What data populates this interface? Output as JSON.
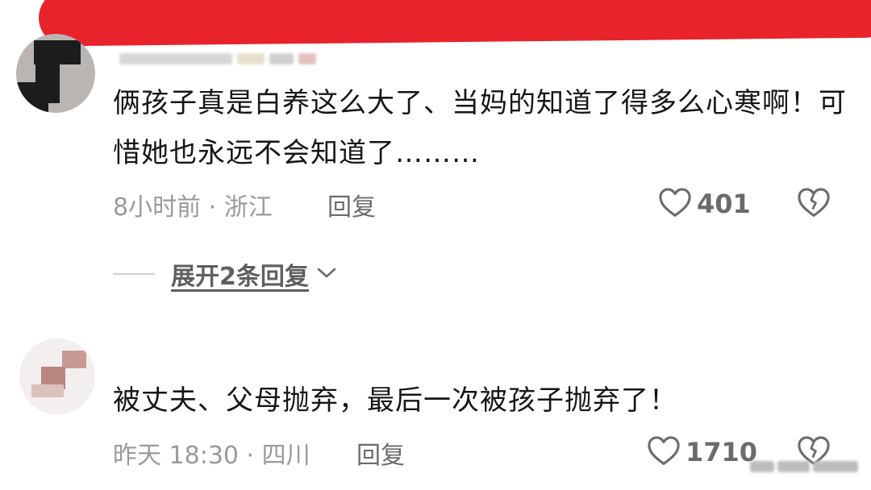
{
  "comment_1": {
    "text": "俩孩子真是白养这么大了、当妈的知道了得多么心寒啊！可惜她也永远不会知道了………",
    "time_location": "8小时前 · 浙江",
    "reply_label": "回复",
    "like_count": "401",
    "expand_replies_label": "展开2条回复"
  },
  "comment_2": {
    "text": "被丈夫、父母抛弃，最后一次被孩子抛弃了！",
    "time_location": "昨天 18:30 · 四川",
    "reply_label": "回复",
    "like_count": "1710"
  },
  "icons": {
    "like": "heart-outline-icon",
    "dislike": "broken-heart-icon",
    "expand": "chevron-down-icon"
  },
  "colors": {
    "highlight": "#e8232b",
    "text": "#161616",
    "meta": "#9a9a9a"
  }
}
